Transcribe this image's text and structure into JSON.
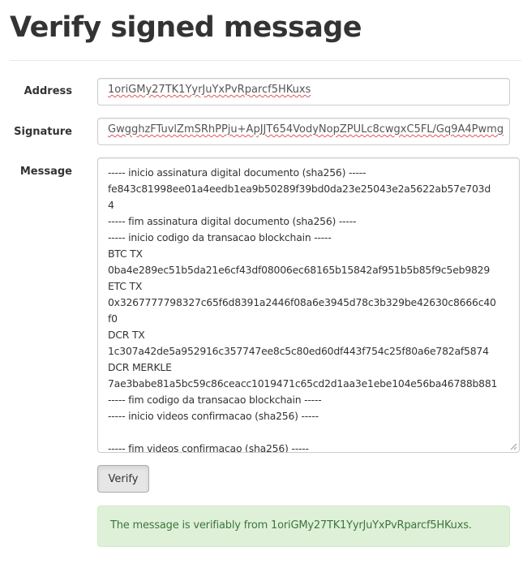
{
  "page": {
    "title": "Verify signed message"
  },
  "form": {
    "address_label": "Address",
    "address_value": "1oriGMy27TK1YyrJuYxPvRparcf5HKuxs",
    "signature_label": "Signature",
    "signature_value": "GwgghzFTuvlZmSRhPPju+ApJJT654VodyNopZPULc8cwgxC5FL/Gq9A4Pwmg",
    "message_label": "Message",
    "message_lines": [
      "----- inicio assinatura digital documento (sha256) -----",
      "fe843c81998ee01a4eedb1ea9b50289f39bd0da23e25043e2a5622ab57e703d",
      "4",
      "----- fim assinatura digital documento (sha256) -----",
      "----- inicio codigo da transacao blockchain -----",
      "BTC TX",
      "0ba4e289ec51b5da21e6cf43df08006ec68165b15842af951b5b85f9c5eb9829",
      "ETC TX",
      "0x3267777798327c65f6d8391a2446f08a6e3945d78c3b329be42630c8666c40",
      "f0",
      "DCR TX",
      "1c307a42de5a952916c357747ee8c5c80ed60df443f754c25f80a6e782af5874",
      "DCR MERKLE",
      "7ae3babe81a5bc59c86ceacc1019471c65cd2d1aa3e1ebe104e56ba46788b881",
      "----- fim codigo da transacao blockchain -----",
      "----- inicio videos confirmacao (sha256) -----",
      "",
      "----- fim videos confirmacao (sha256) -----"
    ],
    "verify_button_label": "Verify"
  },
  "result": {
    "message": "The message is verifiably from 1oriGMy27TK1YyrJuYxPvRparcf5HKuxs.",
    "status_color": "#3c763d",
    "background_color": "#dff0d8"
  }
}
